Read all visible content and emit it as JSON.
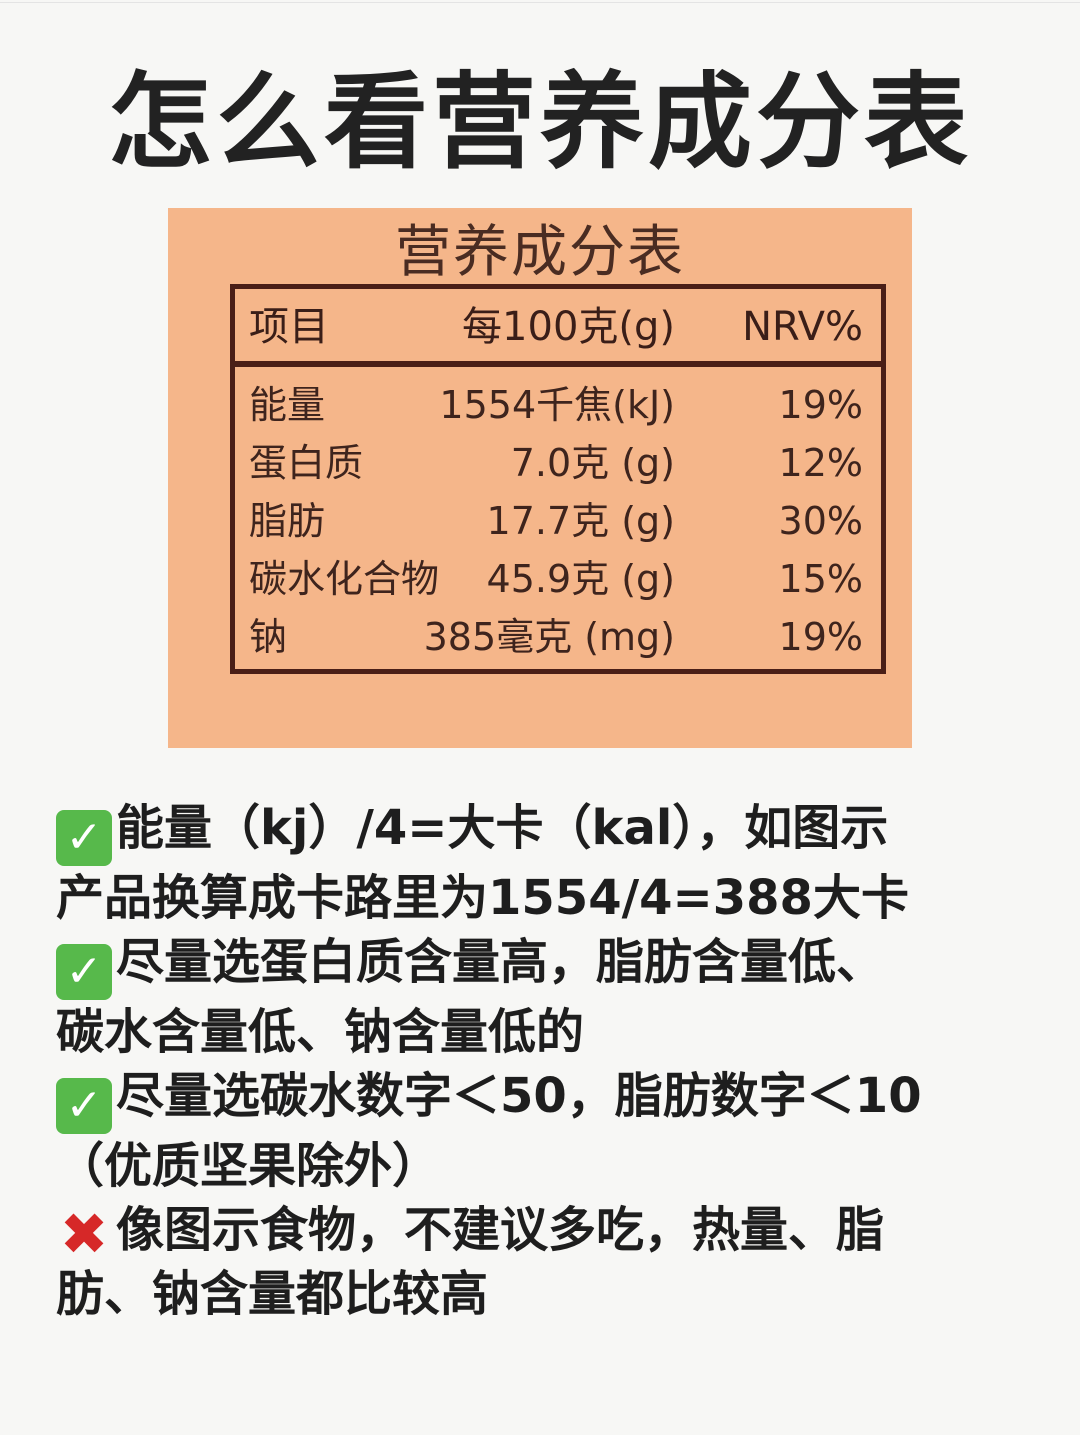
{
  "title": "怎么看营养成分表",
  "label": {
    "title": "营养成分表",
    "header": {
      "item": "项目",
      "amount": "每100克(g)",
      "nrv": "NRV%"
    },
    "rows": [
      {
        "name": "能量",
        "amount": "1554千焦(kJ)",
        "nrv": "19%"
      },
      {
        "name": "蛋白质",
        "amount": "7.0克 (g)",
        "nrv": "12%"
      },
      {
        "name": "脂肪",
        "amount": "17.7克 (g)",
        "nrv": "30%"
      },
      {
        "name": "碳水化合物",
        "amount": "45.9克 (g)",
        "nrv": "15%"
      },
      {
        "name": "钠",
        "amount": "385毫克 (mg)",
        "nrv": "19%"
      }
    ]
  },
  "tips": [
    {
      "icon": "check-icon",
      "symbol": "✓",
      "lines": [
        "能量（kj）/4=大卡（kal），如图示",
        "产品换算成卡路里为1554/4=388大卡"
      ]
    },
    {
      "icon": "check-icon",
      "symbol": "✓",
      "lines": [
        "尽量选蛋白质含量高，脂肪含量低、",
        "碳水含量低、钠含量低的"
      ]
    },
    {
      "icon": "check-icon",
      "symbol": "✓",
      "lines": [
        "尽量选碳水数字＜50，脂肪数字＜10",
        "（优质坚果除外）"
      ]
    },
    {
      "icon": "cross-icon",
      "symbol": "✖",
      "lines": [
        "像图示食物，不建议多吃，热量、脂",
        "肪、钠含量都比较高"
      ]
    }
  ],
  "colors": {
    "label_bg": "#f5b68a",
    "label_ink": "#4a1f17",
    "check": "#57b94b",
    "cross": "#d62828"
  }
}
